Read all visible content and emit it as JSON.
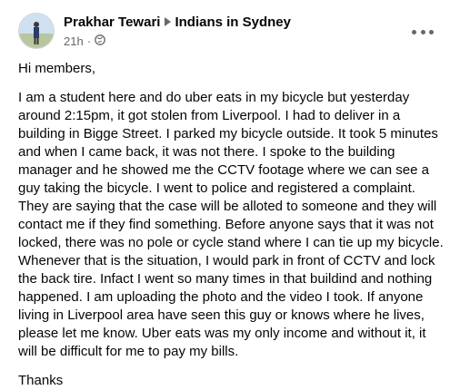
{
  "post": {
    "author": "Prakhar Tewari",
    "group": "Indians in Sydney",
    "time": "21h",
    "dot": "·",
    "privacy_icon": "public-globe-icon",
    "more_icon": "more-options-icon",
    "avatar_icon": "profile-avatar",
    "greeting": "Hi members,",
    "lines": [
      "I am a student here and do uber eats in my bicycle but yesterday",
      "around 2:15pm, it got stolen from Liverpool. I had to deliver in a",
      "building in Bigge Street. I parked my bicycle outside. It took 5 minutes",
      "and when I came back, it was not there. I spoke to the building",
      "manager and he showed me the CCTV footage where we can see a",
      "guy taking the bicycle. I went to police and registered a complaint.",
      "They are saying that the case will be alloted to someone and they will",
      "contact me if they find something. Before anyone says that it was not",
      "locked, there was no pole or cycle stand where I can tie up my bicycle.",
      "Whenever that is the situation, I would park in front of CCTV and lock",
      "the back tire. Infact I went so many times in that buildind and nothing",
      "happened. I am uploading the photo and the video I took. If anyone",
      "living in Liverpool area have seen this guy or knows where he lives,",
      "please let me know. Uber eats was my only income and without it, it",
      "will be difficult for me to pay my bills."
    ],
    "closing": "Thanks"
  }
}
